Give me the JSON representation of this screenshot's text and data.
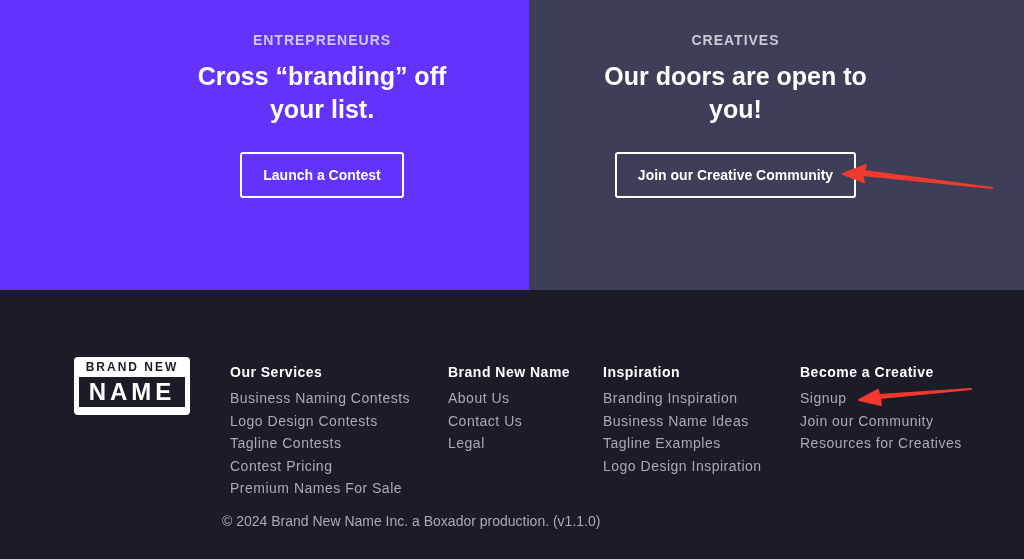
{
  "hero_panels": [
    {
      "kicker": "ENTREPRENEURS",
      "headline": "Cross “branding” off your list.",
      "button": "Launch a Contest",
      "color": "#6332fb"
    },
    {
      "kicker": "CREATIVES",
      "headline": "Our doors are open to you!",
      "button": "Join our Creative Community",
      "color": "#3d3f58"
    }
  ],
  "footer": {
    "logo": {
      "top": "BRAND NEW",
      "bottom": "NAME"
    },
    "columns": [
      {
        "heading": "Our Services",
        "links": [
          "Business Naming Contests",
          "Logo Design Contests",
          "Tagline Contests",
          "Contest Pricing",
          "Premium Names For Sale"
        ]
      },
      {
        "heading": "Brand New Name",
        "links": [
          "About Us",
          "Contact Us",
          "Legal"
        ]
      },
      {
        "heading": "Inspiration",
        "links": [
          "Branding Inspiration",
          "Business Name Ideas",
          "Tagline Examples",
          "Logo Design Inspiration"
        ]
      },
      {
        "heading": "Become a Creative",
        "links": [
          "Signup",
          "Join our Community",
          "Resources for Creatives"
        ]
      }
    ],
    "copyright": "© 2024 Brand New Name Inc. a Boxador production. (v1.1.0)"
  }
}
